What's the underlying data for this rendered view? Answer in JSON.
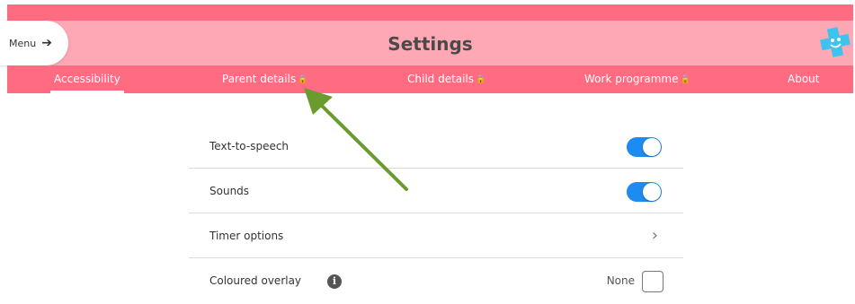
{
  "header": {
    "title": "Settings",
    "menu_label": "Menu",
    "menu_arrow": "➔"
  },
  "tabs": [
    {
      "label": "Accessibility",
      "locked": false,
      "active": true
    },
    {
      "label": "Parent details",
      "locked": true,
      "active": false
    },
    {
      "label": "Child details",
      "locked": true,
      "active": false
    },
    {
      "label": "Work programme",
      "locked": true,
      "active": false
    },
    {
      "label": "About",
      "locked": false,
      "active": false
    }
  ],
  "lock_glyph": "🔒",
  "settings": {
    "text_to_speech": {
      "label": "Text-to-speech",
      "enabled": true
    },
    "sounds": {
      "label": "Sounds",
      "enabled": true
    },
    "timer_options": {
      "label": "Timer options",
      "chevron": "›"
    },
    "coloured_overlay": {
      "label": "Coloured overlay",
      "info": "i",
      "value": "None"
    }
  },
  "colors": {
    "header_bg": "#ffa8b5",
    "tab_bar_bg": "#ff6b81",
    "toggle_on": "#1e8bf0",
    "annotation_arrow": "#6a9b2f",
    "logo": "#3cc3ee"
  },
  "icons": [
    "arrow-right-icon",
    "lock-icon",
    "logo-icon",
    "chevron-right-icon",
    "info-icon",
    "annotation-arrow-icon"
  ]
}
